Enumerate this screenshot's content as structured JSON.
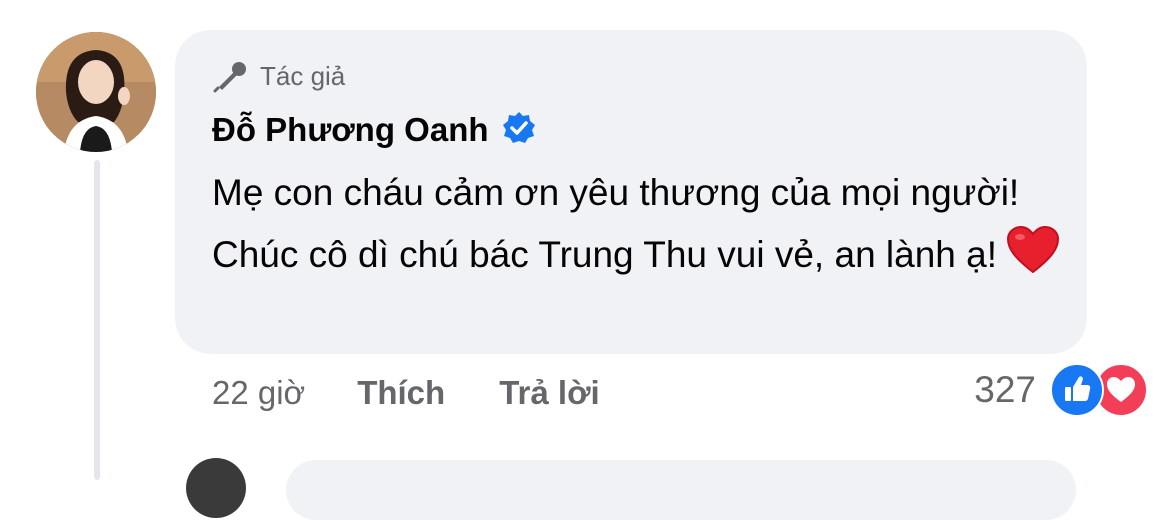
{
  "comment": {
    "author_badge": "Tác giả",
    "author_name": "Đỗ Phương Oanh",
    "verified": true,
    "text": "Mẹ con cháu cảm ơn yêu thương của mọi người! Chúc cô dì chú bác Trung Thu vui vẻ, an lành ạ!",
    "emoji": "heart",
    "time": "22 giờ",
    "like_label": "Thích",
    "reply_label": "Trả lời",
    "reaction_count": "327",
    "reactions": [
      "like",
      "love"
    ]
  },
  "colors": {
    "bubble": "#f0f2f5",
    "secondary_text": "#65676b",
    "verified_blue": "#1877f2",
    "like_blue": "#1877f2",
    "love_red": "#f33e58"
  }
}
